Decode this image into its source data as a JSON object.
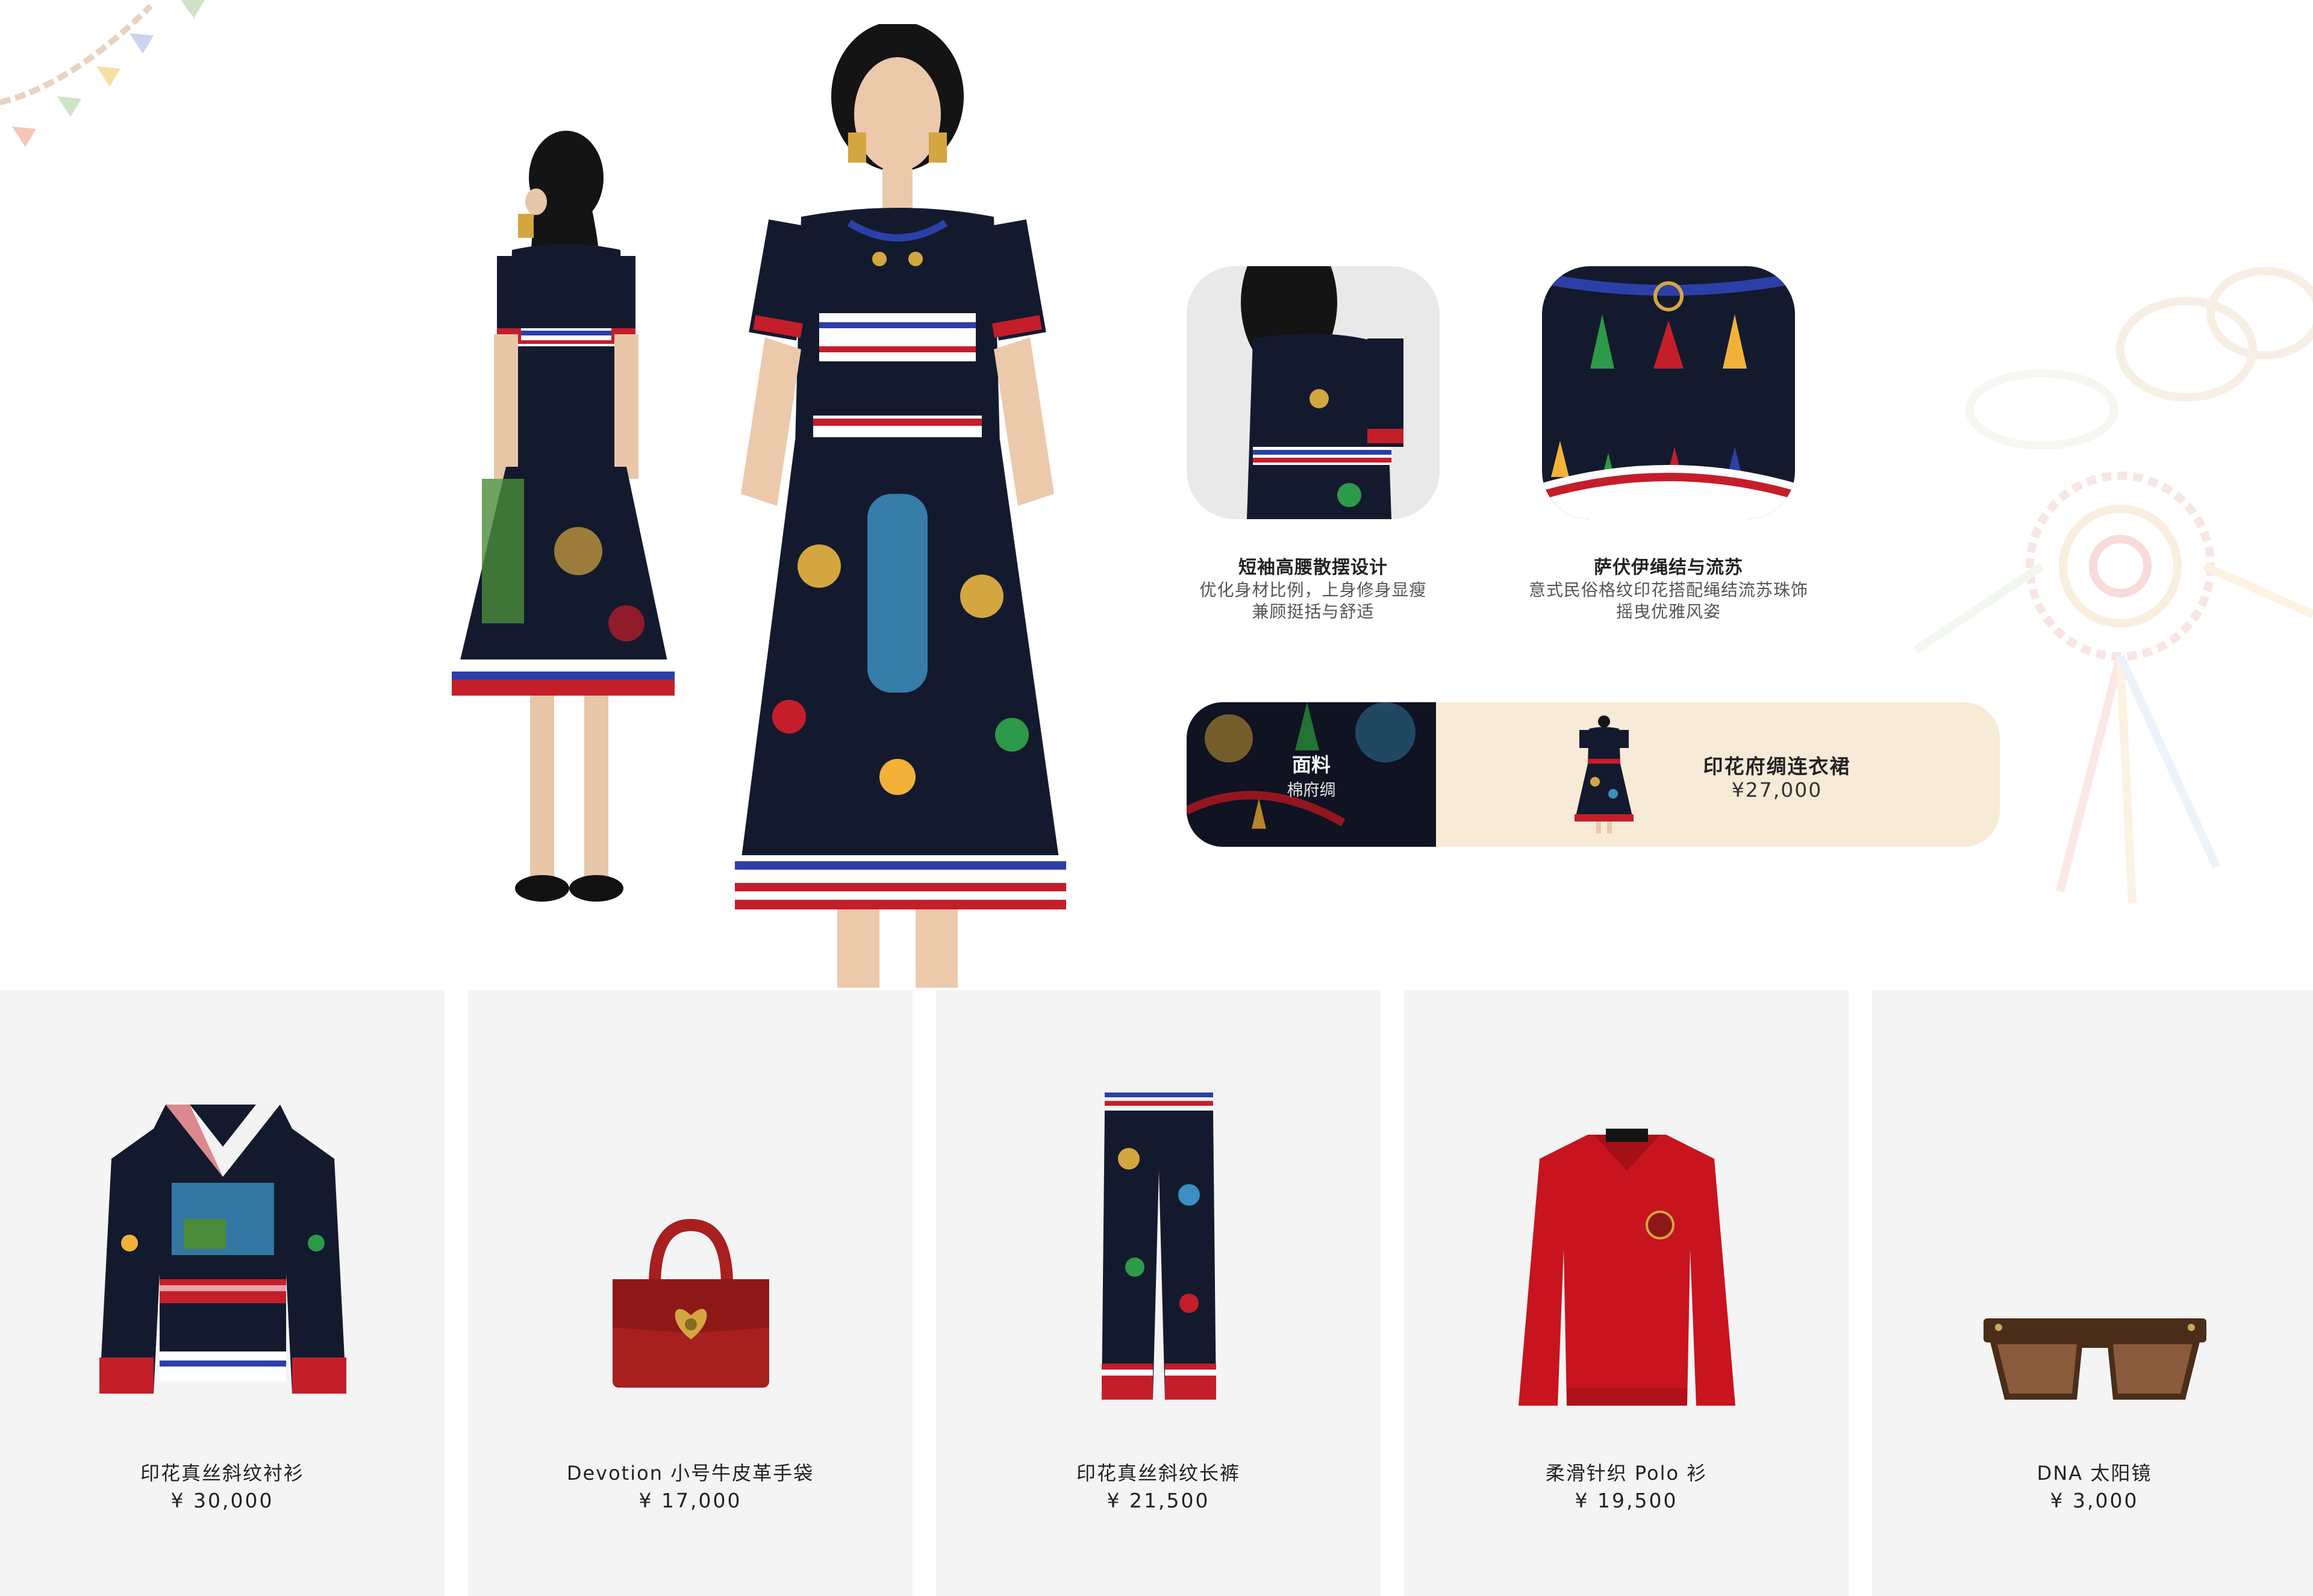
{
  "features": [
    {
      "title": "短袖高腰散摆设计",
      "desc_line1": "优化身材比例，上身修身显瘦",
      "desc_line2": "兼顾挺括与舒适"
    },
    {
      "title": "萨伏伊绳结与流苏",
      "desc_line1": "意式民俗格纹印花搭配绳结流苏珠饰",
      "desc_line2": "摇曳优雅风姿"
    }
  ],
  "fabric": {
    "label": "面料",
    "value": "棉府绸"
  },
  "featured_product": {
    "name": "印花府绸连衣裙",
    "price": "¥27,000"
  },
  "products": [
    {
      "name": "印花真丝斜纹衬衫",
      "price": "¥ 30,000"
    },
    {
      "name": "Devotion 小号牛皮革手袋",
      "price": "¥ 17,000"
    },
    {
      "name": "印花真丝斜纹长裤",
      "price": "¥ 21,500"
    },
    {
      "name": "柔滑针织 Polo 衫",
      "price": "¥ 19,500"
    },
    {
      "name": "DNA 太阳镜",
      "price": "¥ 3,000"
    }
  ],
  "colors": {
    "banner_bg": "#f7ead6",
    "card_bg": "#f4f4f4",
    "dress_navy": "#141a2e",
    "polo_red": "#c8141e",
    "bag_red": "#a81f1f"
  }
}
